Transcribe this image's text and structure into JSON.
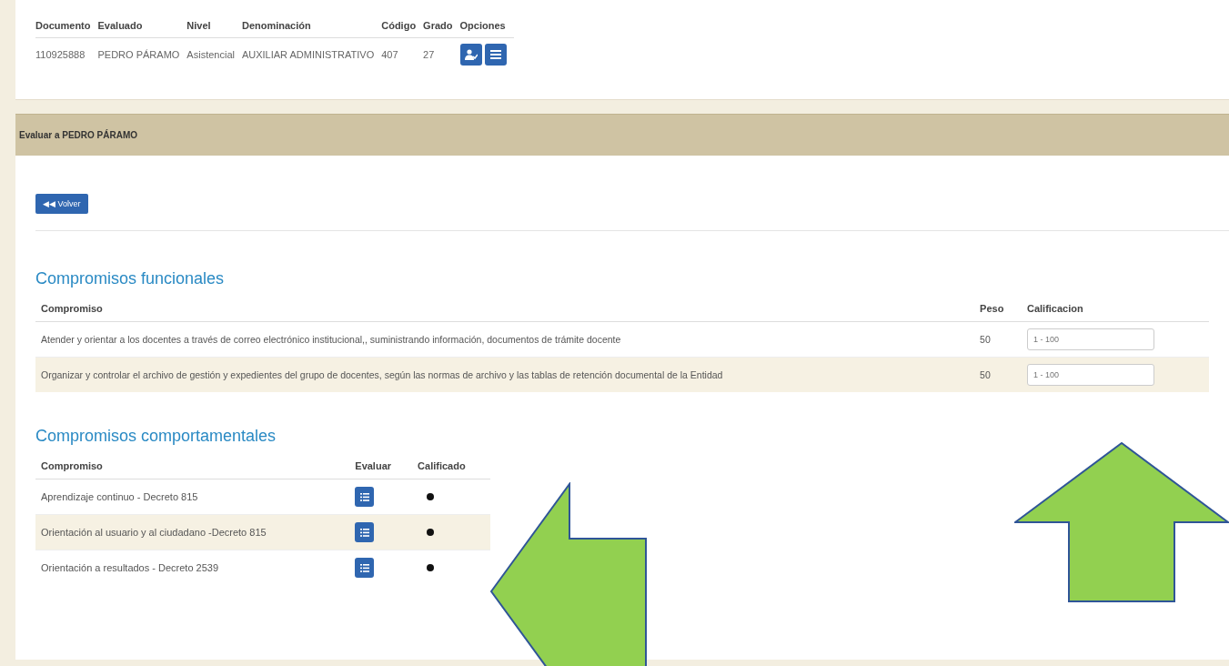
{
  "evaluado_table": {
    "columns": [
      "Documento",
      "Evaluado",
      "Nivel",
      "Denominación",
      "Código",
      "Grado",
      "Opciones"
    ],
    "rows": [
      {
        "documento": "110925888",
        "evaluado": "PEDRO PÁRAMO",
        "nivel": "Asistencial",
        "denominacion": "AUXILIAR ADMINISTRATIVO",
        "codigo": "407",
        "grado": "27"
      }
    ]
  },
  "panel": {
    "title": "Evaluar a PEDRO PÁRAMO",
    "back_button": "◀◀ Volver"
  },
  "funcionales": {
    "title": "Compromisos funcionales",
    "columns": [
      "Compromiso",
      "Peso",
      "Calificacion"
    ],
    "rows": [
      {
        "compromiso": "Atender y orientar a los docentes a través de correo electrónico institucional,, suministrando información, documentos de trámite docente",
        "peso": "50",
        "placeholder": "1 - 100"
      },
      {
        "compromiso": "Organizar y controlar el archivo de gestión y expedientes del grupo de docentes, según las normas de archivo y las tablas de retención documental de la Entidad",
        "peso": "50",
        "placeholder": "1 - 100"
      }
    ]
  },
  "comportamentales": {
    "title": "Compromisos comportamentales",
    "columns": [
      "Compromiso",
      "Evaluar",
      "Calificado"
    ],
    "rows": [
      {
        "compromiso": "Aprendizaje continuo - Decreto 815"
      },
      {
        "compromiso": "Orientación al usuario y al ciudadano -Decreto 815"
      },
      {
        "compromiso": "Orientación a resultados - Decreto 2539"
      }
    ]
  }
}
